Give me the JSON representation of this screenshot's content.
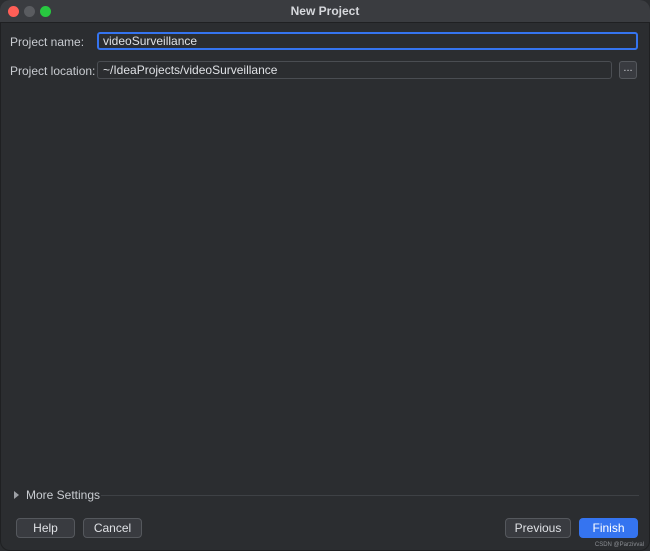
{
  "window": {
    "title": "New Project"
  },
  "form": {
    "name_label": "Project name:",
    "name_value": "videoSurveillance",
    "location_label": "Project location:",
    "location_value": "~/IdeaProjects/videoSurveillance",
    "browse_label": "..."
  },
  "more_settings": {
    "label": "More Settings"
  },
  "buttons": {
    "help": "Help",
    "cancel": "Cancel",
    "previous": "Previous",
    "finish": "Finish"
  },
  "watermark": "CSDN @Parzivval",
  "colors": {
    "background": "#2b2d30",
    "accent": "#3574f0",
    "close": "#ff5f57",
    "maximize": "#28c840"
  }
}
